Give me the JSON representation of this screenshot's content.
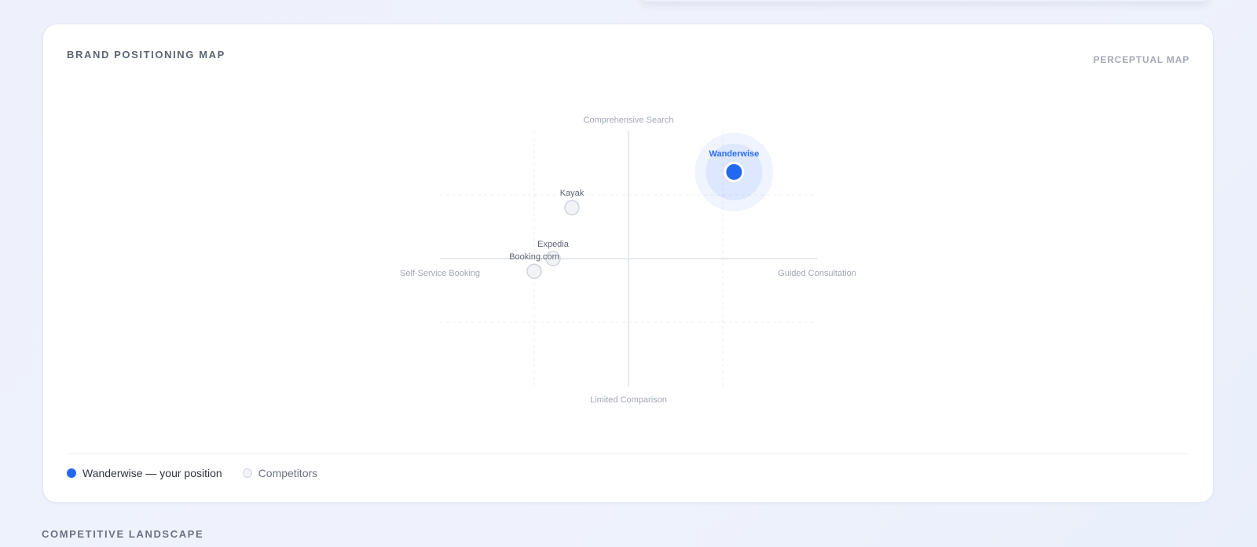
{
  "card": {
    "title": "BRAND POSITIONING MAP",
    "badge": "PERCEPTUAL MAP"
  },
  "chart_data": {
    "type": "scatter",
    "axes": {
      "top": "Comprehensive Search",
      "bottom": "Limited Comparison",
      "left": "Self-Service Booking",
      "right": "Guided Consultation"
    },
    "xlim": [
      -1,
      1
    ],
    "ylim": [
      -1,
      1
    ],
    "grid": true,
    "points": [
      {
        "name": "Wanderwise",
        "x": 0.56,
        "y": 0.68,
        "primary": true
      },
      {
        "name": "Kayak",
        "x": -0.3,
        "y": 0.4,
        "primary": false
      },
      {
        "name": "Expedia",
        "x": -0.4,
        "y": 0.0,
        "primary": false
      },
      {
        "name": "Booking.com",
        "x": -0.5,
        "y": -0.1,
        "primary": false
      }
    ],
    "colors": {
      "primary": "#2468f2",
      "competitor": "#f1f3f7"
    }
  },
  "legend": {
    "you": "Wanderwise — your position",
    "competitors": "Competitors"
  },
  "section": {
    "title": "COMPETITIVE LANDSCAPE"
  }
}
